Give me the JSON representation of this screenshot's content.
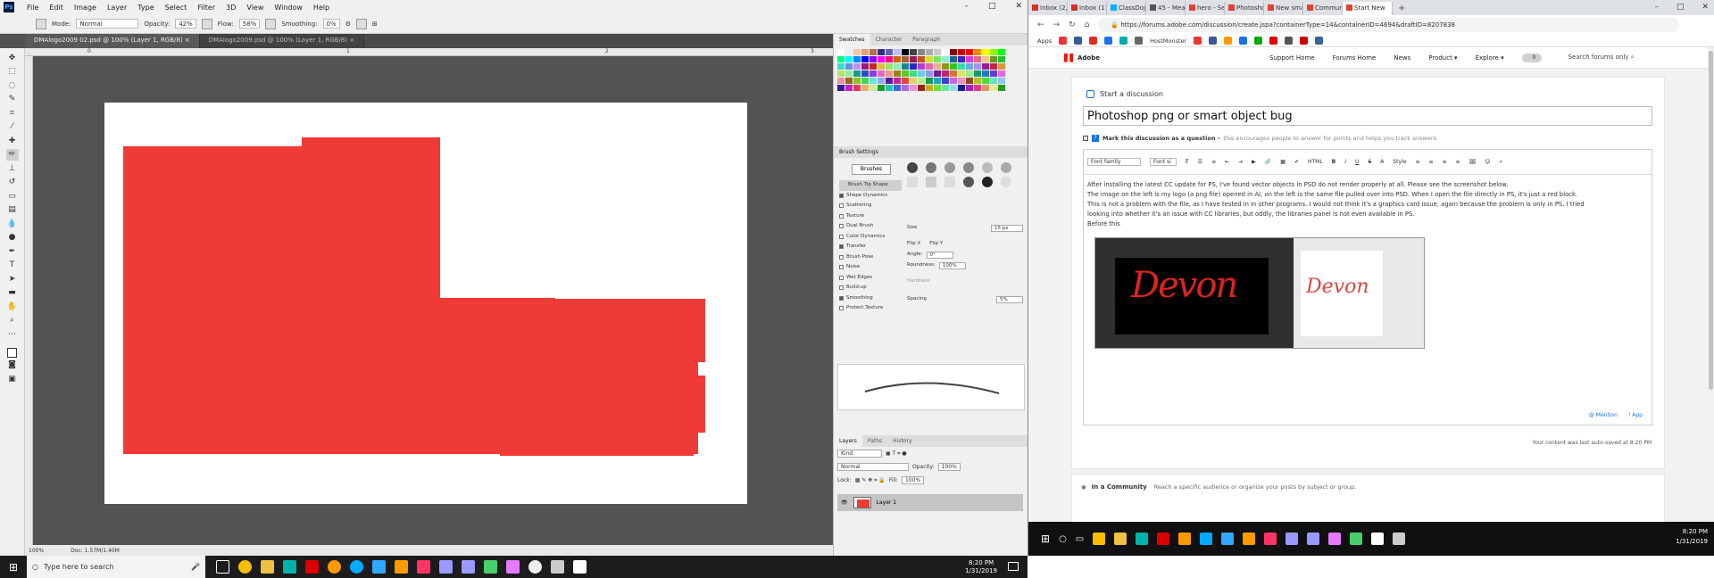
{
  "ps": {
    "menu": [
      "File",
      "Edit",
      "Image",
      "Layer",
      "Type",
      "Select",
      "Filter",
      "3D",
      "View",
      "Window",
      "Help"
    ],
    "options": {
      "mode_label": "Mode:",
      "mode": "Normal",
      "opacity_label": "Opacity:",
      "opacity": "42%",
      "flow_label": "Flow:",
      "flow": "58%",
      "smoothing_label": "Smoothing:",
      "smoothing": "0%"
    },
    "tabs": [
      {
        "label": "DMAlogo2009 02.psd @ 100% (Layer 1, RGB/8)"
      },
      {
        "label": "DMAlogo2009.psd @ 100% (Layer 1, RGB/8)"
      }
    ],
    "ruler": [
      "0",
      "1",
      "2",
      "3"
    ],
    "status": {
      "zoom": "100%",
      "doc": "Doc: 1.57M/1.40M"
    },
    "swatches_tabs": [
      "Swatches",
      "Character",
      "Paragraph"
    ],
    "brush": {
      "title": "Brush Settings",
      "brushes_btn": "Brushes",
      "items": [
        {
          "label": "Brush Tip Shape",
          "on": false,
          "sel": true
        },
        {
          "label": "Shape Dynamics",
          "on": true
        },
        {
          "label": "Scattering",
          "on": false
        },
        {
          "label": "Texture",
          "on": false
        },
        {
          "label": "Dual Brush",
          "on": false
        },
        {
          "label": "Color Dynamics",
          "on": false
        },
        {
          "label": "Transfer",
          "on": true
        },
        {
          "label": "Brush Pose",
          "on": false
        },
        {
          "label": "Noise",
          "on": false
        },
        {
          "label": "Wet Edges",
          "on": false
        },
        {
          "label": "Build-up",
          "on": false
        },
        {
          "label": "Smoothing",
          "on": true
        },
        {
          "label": "Protect Texture",
          "on": false
        }
      ],
      "size_label": "Size",
      "size": "15 px",
      "flip_x": "Flip X",
      "flip_y": "Flip Y",
      "angle_label": "Angle:",
      "angle": "0°",
      "roundness_label": "Roundness:",
      "roundness": "100%",
      "hardness_label": "Hardness",
      "spacing_label": "Spacing",
      "spacing": "5%"
    },
    "layers": {
      "tabs": [
        "Layers",
        "Paths",
        "History"
      ],
      "kind": "Kind",
      "blend": "Normal",
      "opacity_label": "Opacity:",
      "opacity": "100%",
      "lock_label": "Lock:",
      "fill_label": "Fill:",
      "fill": "100%",
      "layer_name": "Layer 1"
    }
  },
  "chrome": {
    "tabs": [
      {
        "label": "Inbox (2,1",
        "c": "#d93025"
      },
      {
        "label": "Inbox (11",
        "c": "#d93025"
      },
      {
        "label": "ClassDojo",
        "c": "#00b2f7"
      },
      {
        "label": "45 - Mea",
        "c": "#555555"
      },
      {
        "label": "hero - Se",
        "c": "#e34133"
      },
      {
        "label": "Photosho",
        "c": "#e34133"
      },
      {
        "label": "New sma",
        "c": "#e34133"
      },
      {
        "label": "Communi",
        "c": "#e34133"
      },
      {
        "label": "Start New",
        "c": "#e34133",
        "active": true
      }
    ],
    "url": "https://forums.adobe.com/discussion/create.jspa?containerType=14&containerID=4694&draftID=8207838",
    "bookmarks": {
      "apps": "Apps",
      "host": "HostMonster"
    }
  },
  "site": {
    "brand": "Adobe",
    "nav": [
      "Support Home",
      "Forums Home",
      "News",
      "Product ▾",
      "Explore ▾"
    ],
    "toggle": "0",
    "search": "Search forums only",
    "start": "Start a discussion",
    "subject": "Photoshop png or smart object bug",
    "mark_bold": "Mark this discussion as a question -",
    "mark_rest": "this encourages people to answer for points and helps you track answers.",
    "editor_tb": {
      "font_family": "Font family",
      "font_size": "Font si",
      "style": "Style",
      "html": "HTML"
    },
    "body": [
      "After installing the latest CC update for PS, I've found vector objects in PSD do not render properly at all.  Please see the screenshot below.",
      "The image on the left is my logo (a png file) opened in AI, on the left is the same file pulled over into PSD.  When I open the file directly in PS, it's just a red block.",
      "This is not a problem with the file, as I have tested in in other programs. I would not think it's a graphics card issue, again because the problem is only in PS. I tried",
      "looking into whether it's an issue with CC libraries, but oddly, the libraries panel is not even available in PS.",
      "Before this"
    ],
    "shot_text_left": "Devon",
    "shot_text_right": "Devon",
    "mention": "@ Mention",
    "app": "! App",
    "autosave": "Your content was last auto-saved at 8:20 PM",
    "community_bold": "In a Community",
    "community_rest": "Reach a specific audience or organize your posts by subject or group."
  },
  "taskbar": {
    "search": "Type here to search",
    "time": "8:20 PM",
    "date": "1/31/2019"
  },
  "colors": {
    "red": "#ef3a36",
    "ps_bg": "#535353",
    "accent": "#1473e6"
  }
}
